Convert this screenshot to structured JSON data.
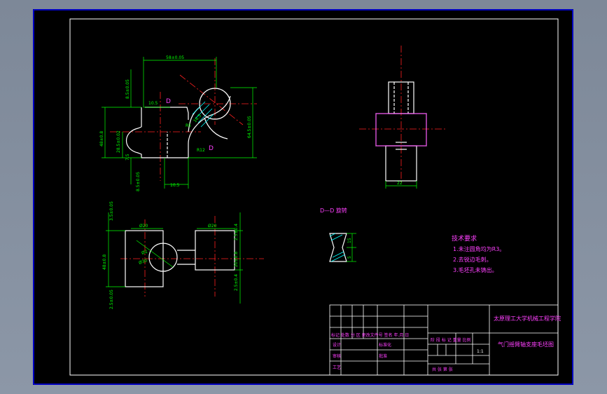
{
  "colors": {
    "background": "#000000",
    "outline": "#ffffff",
    "dimension": "#00ff00",
    "centerline": "#ff2020",
    "text": "#ff40ff",
    "hatch": "#00ffff",
    "frame": "#0000ff"
  },
  "front_view": {
    "dims": {
      "top_width": "58±0.05",
      "left_height": "48±0.8",
      "right_height": "64.5±0.05",
      "top_offset": "8.5±0.05",
      "bore_offset": "10.5",
      "mid_height": "28.5±0.02",
      "small_step": "7.5",
      "bottom_offset": "8.5±0.05",
      "bottom_width": "10.5",
      "radius": "R12",
      "radius2": "R5",
      "angle_dim": "16.5"
    },
    "section_mark_1": "D",
    "section_mark_2": "D"
  },
  "side_view": {
    "dims": {
      "bottom_width": "22"
    }
  },
  "top_view": {
    "dims": {
      "left_top": "3.5±0.05",
      "left_height": "48±0.8",
      "left_bottom": "2.5±0.05",
      "dia_left": "Ø20",
      "dia_right": "Ø20",
      "right_top": "2.5±0.4",
      "right_height": "20±0.8",
      "right_bottom": "2.5±0.4",
      "inner_dia": "Ø2",
      "inner_dia2": "Ø30"
    }
  },
  "section_view": {
    "title": "D—D 旋转",
    "dims": {
      "d1": "15",
      "d2": "5"
    }
  },
  "tech_requirements": {
    "heading": "技术要求",
    "items": [
      "1.未注圆角均为R3。",
      "2.去锐边毛刺。",
      "3.毛坯孔未铸出。"
    ]
  },
  "title_block": {
    "school": "太原理工大学机械工程学院",
    "part_name": "气门摇臂轴支座毛坯图",
    "header_row": "标记 处数 分 区 更改文件号 签名 年.月.日",
    "sign_rows": [
      "设计",
      "审核",
      "工艺"
    ],
    "std": "标准化",
    "approve": "批准",
    "stage_row": "阶 段 标 记  重量  比例",
    "scale": "1:1",
    "sheet_row": "共  张  第  张"
  }
}
